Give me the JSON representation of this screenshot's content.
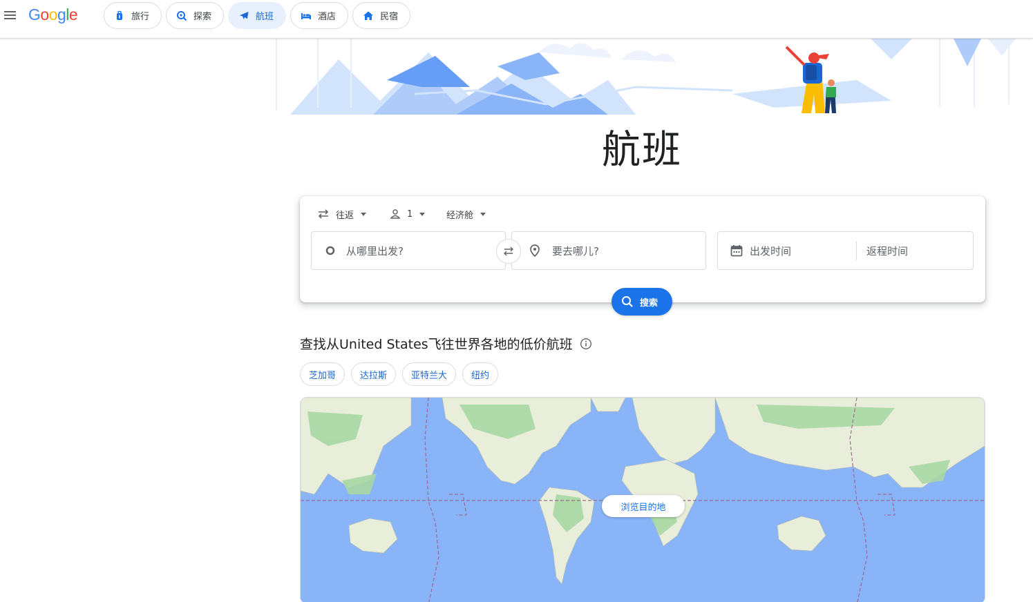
{
  "header": {
    "logo": "Google",
    "nav": [
      {
        "label": "旅行",
        "icon": "luggage-icon",
        "active": false
      },
      {
        "label": "探索",
        "icon": "explore-search-icon",
        "active": false
      },
      {
        "label": "航班",
        "icon": "airplane-icon",
        "active": true
      },
      {
        "label": "酒店",
        "icon": "bed-icon",
        "active": false
      },
      {
        "label": "民宿",
        "icon": "house-icon",
        "active": false
      }
    ]
  },
  "page": {
    "title": "航班"
  },
  "search": {
    "trip_type": "往返",
    "passengers": "1",
    "cabin_class": "经济舱",
    "origin_placeholder": "从哪里出发?",
    "destination_placeholder": "要去哪儿?",
    "depart_placeholder": "出发时间",
    "return_placeholder": "返程时间",
    "search_label": "搜索"
  },
  "explore": {
    "title": "查找从United States飞往世界各地的低价航班",
    "cities": [
      "芝加哥",
      "达拉斯",
      "亚特兰大",
      "纽约"
    ],
    "map_button": "浏览目的地"
  },
  "colors": {
    "accent": "#1a73e8",
    "active_chip_bg": "#e8f0fe",
    "ocean": "#8ab4f8",
    "land": "#e9eedb",
    "forest": "#a8d8a4"
  }
}
